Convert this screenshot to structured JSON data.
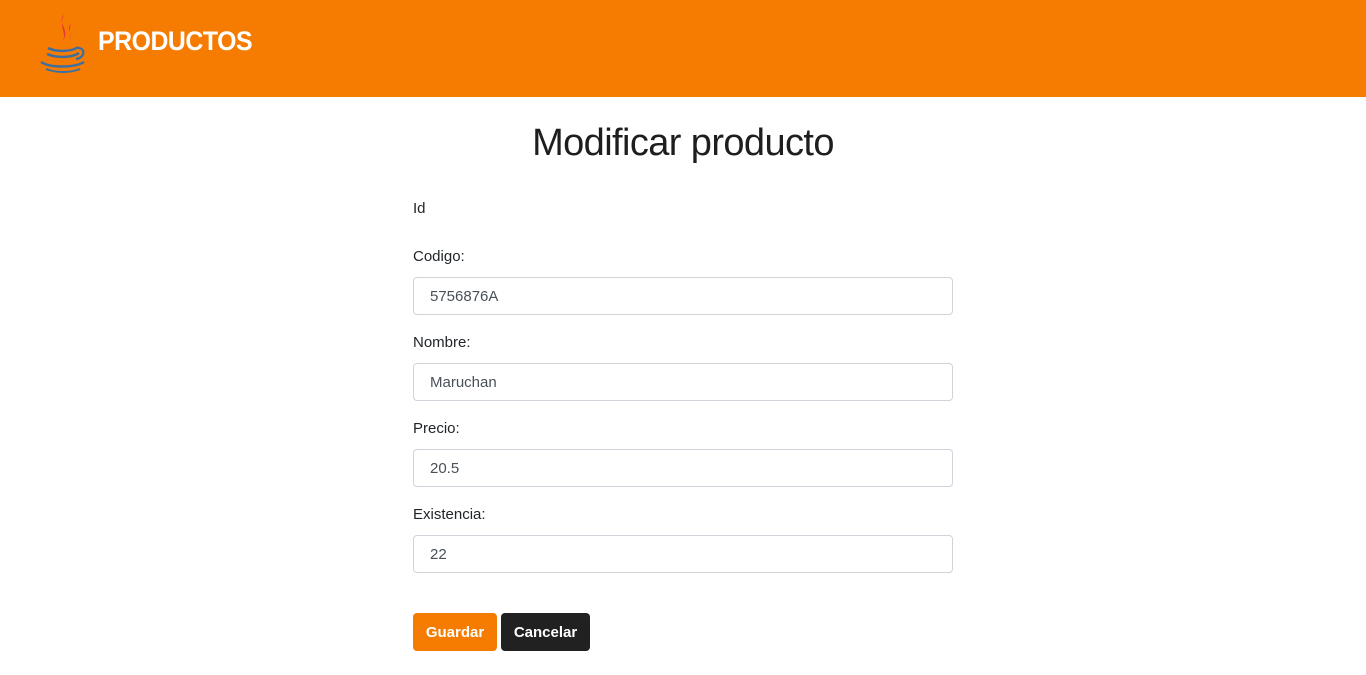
{
  "header": {
    "brand": "PRODUCTOS",
    "logo_icon": "java-coffee-cup-icon",
    "background_color": "#f57c00"
  },
  "main": {
    "title": "Modificar producto"
  },
  "form": {
    "id_label": "Id",
    "codigo_label": "Codigo:",
    "codigo_value": "5756876A",
    "nombre_label": "Nombre:",
    "nombre_value": "Maruchan",
    "precio_label": "Precio:",
    "precio_value": "20.5",
    "existencia_label": "Existencia:",
    "existencia_value": "22"
  },
  "buttons": {
    "save_label": "Guardar",
    "save_color": "#f57c00",
    "cancel_label": "Cancelar",
    "cancel_color": "#212121"
  }
}
